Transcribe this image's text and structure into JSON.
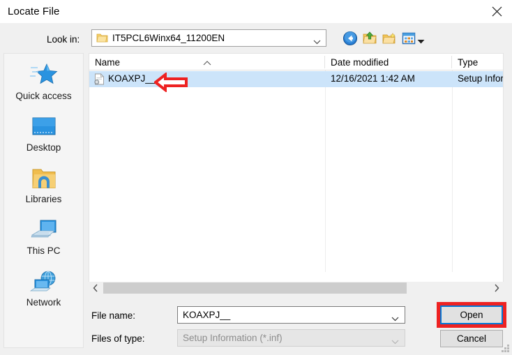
{
  "window": {
    "title": "Locate File",
    "close_icon": "close-icon"
  },
  "toolbar": {
    "lookin_label": "Look in:",
    "lookin_value": "IT5PCL6Winx64_11200EN",
    "lookin_folder_icon": "folder-icon",
    "lookin_chevron_icon": "chevron-down-icon",
    "buttons": [
      {
        "name": "back-button",
        "icon": "back-arrow-icon"
      },
      {
        "name": "up-one-level-button",
        "icon": "up-folder-icon"
      },
      {
        "name": "create-new-folder-button",
        "icon": "new-folder-icon"
      },
      {
        "name": "views-button",
        "icon": "views-icon"
      }
    ],
    "views_dropdown_icon": "chevron-down-icon"
  },
  "places": {
    "items": [
      {
        "label": "Quick access",
        "icon": "star-icon"
      },
      {
        "label": "Desktop",
        "icon": "monitor-icon"
      },
      {
        "label": "Libraries",
        "icon": "libraries-folder-icon"
      },
      {
        "label": "This PC",
        "icon": "computer-icon"
      },
      {
        "label": "Network",
        "icon": "network-globe-icon"
      }
    ]
  },
  "filelist": {
    "columns": [
      "Name",
      "Date modified",
      "Type"
    ],
    "sort_indicator_icon": "sort-ascending-icon",
    "rows": [
      {
        "name": "KOAXPJ__",
        "date_modified": "12/16/2021 1:42 AM",
        "type": "Setup Infor",
        "icon": "setup-information-file-icon",
        "selected": true
      }
    ]
  },
  "scrollbar": {
    "left_icon": "chevron-left-icon",
    "right_icon": "chevron-right-icon"
  },
  "fields": {
    "filename_label": "File name:",
    "filename_value": "KOAXPJ__",
    "filename_chevron_icon": "chevron-down-icon",
    "filetype_label": "Files of type:",
    "filetype_value": "Setup Information (*.inf)",
    "filetype_chevron_icon": "chevron-down-icon"
  },
  "buttons": {
    "open_label": "Open",
    "cancel_label": "Cancel"
  },
  "annotations": {
    "arrow_color": "#ee2222",
    "highlight_color": "#ee2222",
    "arrow_target": "KOAXPJ__",
    "highlight_target": "Open"
  },
  "colors": {
    "selection": "#cce4fa",
    "focus_border": "#0078d7",
    "dialog_background": "#f0f0f0"
  }
}
